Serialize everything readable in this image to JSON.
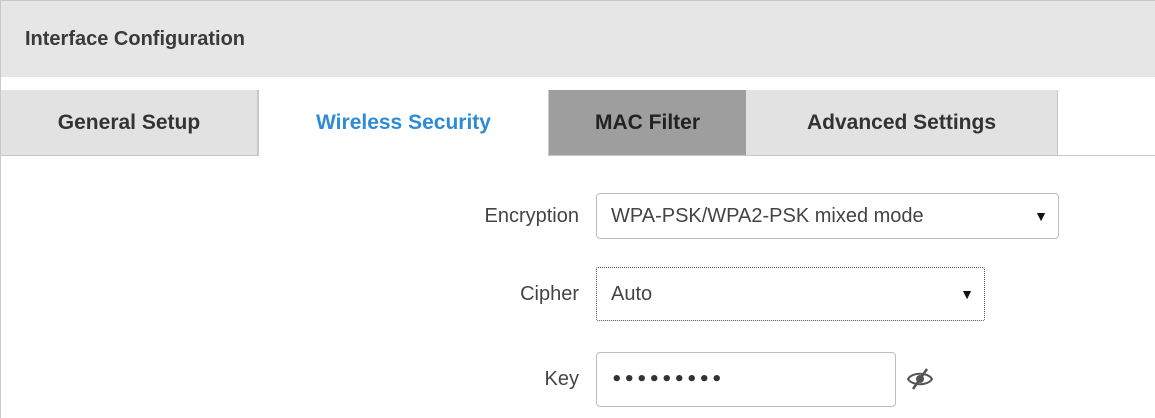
{
  "panel": {
    "title": "Interface Configuration"
  },
  "tabs": [
    {
      "label": "General Setup",
      "active": false
    },
    {
      "label": "Wireless Security",
      "active": true
    },
    {
      "label": "MAC Filter",
      "active": false
    },
    {
      "label": "Advanced Settings",
      "active": false
    }
  ],
  "form": {
    "encryption": {
      "label": "Encryption",
      "value": "WPA-PSK/WPA2-PSK mixed mode"
    },
    "cipher": {
      "label": "Cipher",
      "value": "Auto"
    },
    "key": {
      "label": "Key",
      "masked_value": "•••••••••",
      "visibility_icon": "eye-slash-icon"
    }
  },
  "colors": {
    "header_bg": "#e6e6e6",
    "active_tab_text": "#2e8bd6",
    "hover_tab_bg": "#9e9e9e",
    "inactive_tab_bg": "#e2e2e2"
  },
  "icons": {
    "dropdown_arrow": "▼"
  }
}
